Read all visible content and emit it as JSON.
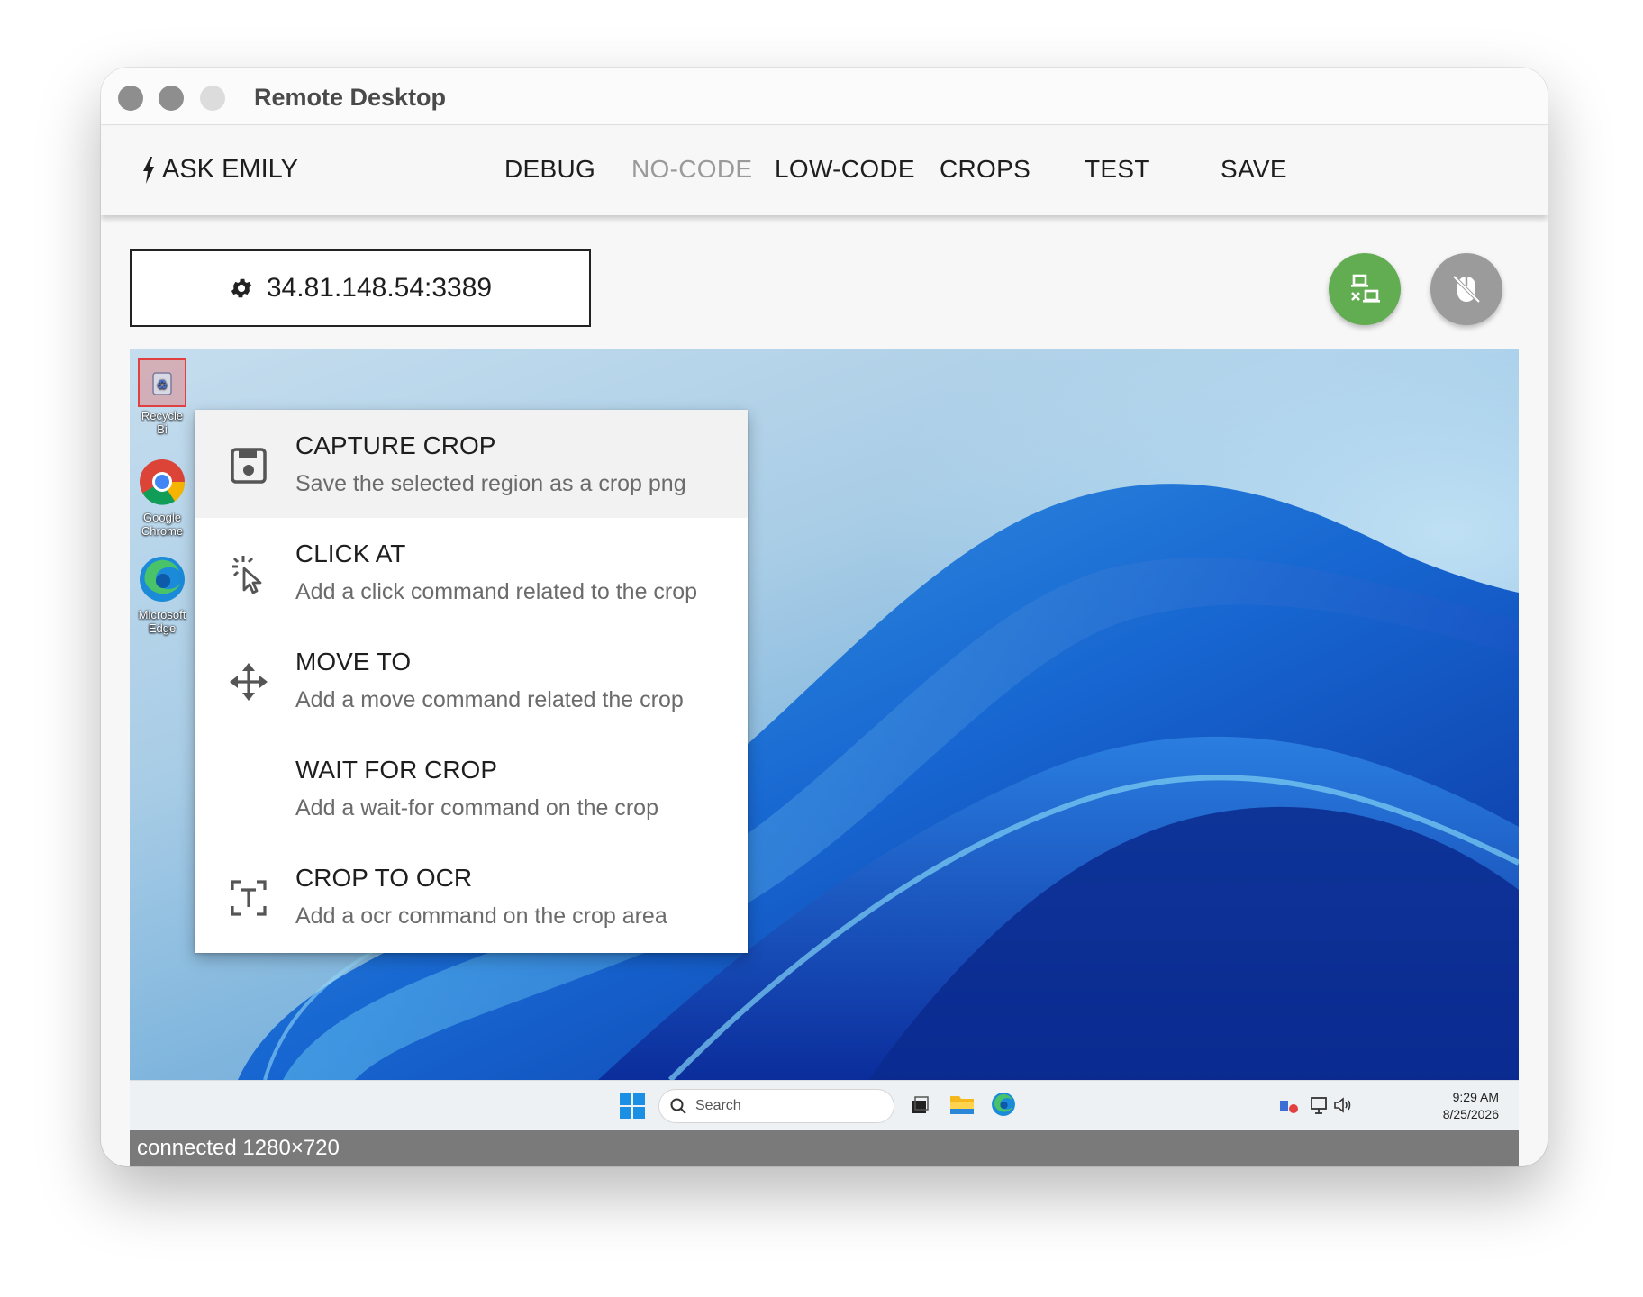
{
  "window": {
    "title": "Remote Desktop"
  },
  "toolbar": {
    "ask_label": "ASK EMILY",
    "items": [
      {
        "label": "DEBUG",
        "disabled": false
      },
      {
        "label": "NO-CODE",
        "disabled": true
      },
      {
        "label": "LOW-CODE",
        "disabled": false
      },
      {
        "label": "CROPS",
        "disabled": false
      },
      {
        "label": "TEST",
        "disabled": false
      },
      {
        "label": "SAVE",
        "disabled": false
      }
    ]
  },
  "connection": {
    "host": "34.81.148.54:3389",
    "icon": "gear-icon"
  },
  "actions": {
    "connect_icon": "remote-connect-icon",
    "mouse_icon": "mouse-off-icon",
    "connect_color": "#62ad52"
  },
  "desktop": {
    "icons": [
      {
        "label": "Recycle Bi",
        "icon": "recycle-bin-icon"
      },
      {
        "label": "Google Chrome",
        "icon": "chrome-icon"
      },
      {
        "label": "Microsoft Edge",
        "icon": "edge-icon"
      }
    ]
  },
  "context_menu": {
    "items": [
      {
        "label": "CAPTURE CROP",
        "desc": "Save the selected region as a crop png",
        "icon": "save-icon"
      },
      {
        "label": "CLICK AT",
        "desc": "Add a click command related to the crop",
        "icon": "click-icon"
      },
      {
        "label": "MOVE TO",
        "desc": "Add a move command related the crop",
        "icon": "move-icon"
      },
      {
        "label": "WAIT FOR CROP",
        "desc": "Add a wait-for command on the crop",
        "icon": ""
      },
      {
        "label": "CROP TO OCR",
        "desc": "Add a ocr command on the crop area",
        "icon": "ocr-icon"
      }
    ]
  },
  "taskbar": {
    "search_placeholder": "Search",
    "time": "9:29 AM",
    "date": "8/25/2026"
  },
  "status": {
    "text": "connected 1280×720"
  }
}
